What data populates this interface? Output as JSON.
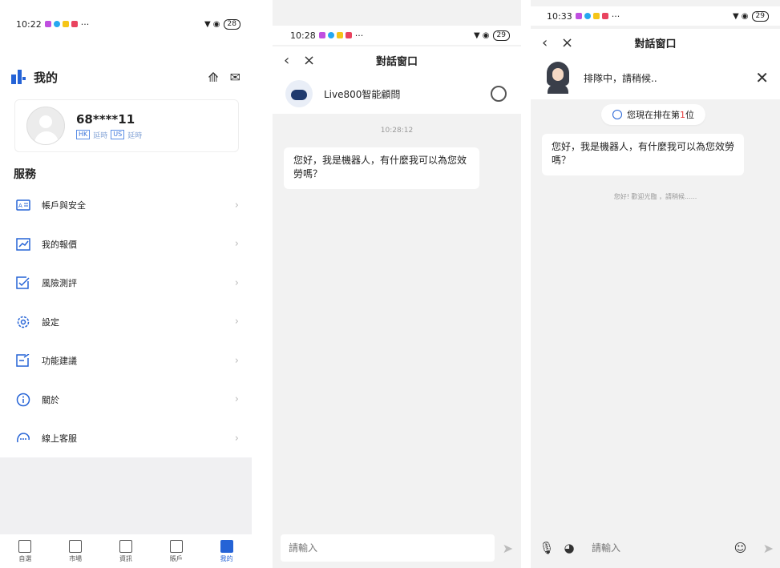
{
  "panel1": {
    "status": {
      "time": "10:22",
      "battery": "28",
      "more": "···"
    },
    "header": {
      "title": "我的"
    },
    "profile": {
      "account": "68****11",
      "hk_tag": "HK",
      "us_tag": "US",
      "delay_label": "延時"
    },
    "services_title": "服務",
    "menu": [
      {
        "label": "帳戶與安全",
        "icon": "id-card-icon"
      },
      {
        "label": "我的報價",
        "icon": "trend-chart-icon"
      },
      {
        "label": "風險測評",
        "icon": "checklist-icon"
      },
      {
        "label": "設定",
        "icon": "gear-icon"
      },
      {
        "label": "功能建議",
        "icon": "edit-note-icon"
      },
      {
        "label": "關於",
        "icon": "info-icon"
      },
      {
        "label": "線上客服",
        "icon": "chat-support-icon"
      }
    ],
    "tabs": [
      {
        "label": "自選",
        "active": false
      },
      {
        "label": "市場",
        "active": false
      },
      {
        "label": "資訊",
        "active": false
      },
      {
        "label": "賬戶",
        "active": false
      },
      {
        "label": "我的",
        "active": true
      }
    ]
  },
  "panel2": {
    "status": {
      "time": "10:28",
      "battery": "29",
      "more": "···"
    },
    "nav_title": "對話窗口",
    "agent_name": "Live800智能顧問",
    "timestamp": "10:28:12",
    "message": "您好，我是機器人，有什麼我可以為您效勞嗎？",
    "input_placeholder": "請輸入"
  },
  "panel3": {
    "status": {
      "time": "10:33",
      "battery": "29",
      "more": "···"
    },
    "nav_title": "對話窗口",
    "agent_status": "排隊中，請稍候..",
    "queue_prefix": "您現在排在第",
    "queue_num": "1",
    "queue_suffix": "位",
    "message": "您好，我是機器人，有什麼我可以為您效勞嗎？",
    "system_msg": "您好! 歡迎光臨 ，請稍候......",
    "input_placeholder": "請輸入"
  },
  "colors": {
    "accent": "#2563d6",
    "chat_bg": "#f2f2f2",
    "queue_num": "#e43b3b"
  }
}
